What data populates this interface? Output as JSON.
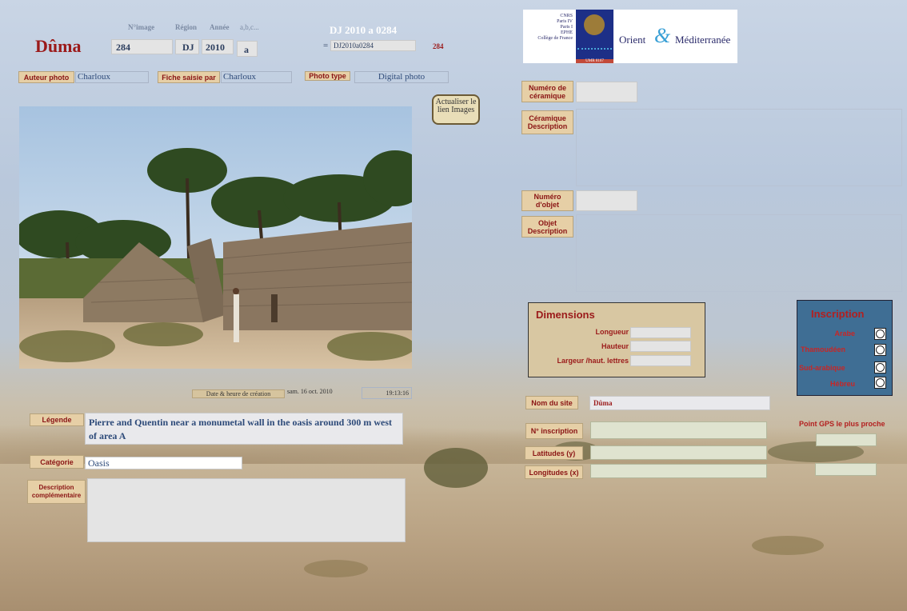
{
  "header": {
    "site_title": "Dûma",
    "labels": {
      "n_image": "N°image",
      "region": "Région",
      "annee": "Année",
      "abc": "a,b,c..."
    },
    "n_image_value": "284",
    "region_value": "DJ",
    "annee_value": "2010",
    "abc_value": "a",
    "ref_title": "DJ 2010 a 0284",
    "equals": "=",
    "ref_code": "DJ2010a0284",
    "ref_number": "284"
  },
  "logo": {
    "left_lines": [
      "CNRS",
      "Paris IV",
      "Paris I",
      "EPHE",
      "Collège de France"
    ],
    "umr": "UMR 8167",
    "text_orient": "Orient",
    "text_amp": "&",
    "text_med": "Méditerranée"
  },
  "photo_meta": {
    "auteur_label": "Auteur photo",
    "auteur_value": "Charloux",
    "fiche_label": "Fiche saisie par",
    "fiche_value": "Charloux",
    "type_label": "Photo type",
    "type_value": "Digital photo"
  },
  "refresh_button": "Actualiser le lien Images",
  "creation": {
    "label": "Date & heure de création",
    "date": "sam. 16 oct. 2010",
    "time": "19:13:16"
  },
  "legende": {
    "label": "Légende",
    "value": "Pierre and Quentin near a monumetal wall in the oasis around 300 m west of area A"
  },
  "categorie": {
    "label": "Catégorie",
    "value": "Oasis"
  },
  "description": {
    "label": "Description complémentaire",
    "value": ""
  },
  "ceramique": {
    "numero_label": "Numéro de céramique",
    "description_label": "Céramique Description"
  },
  "objet": {
    "numero_label": "Numéro d'objet",
    "description_label": "Objet Description"
  },
  "dimensions": {
    "title": "Dimensions",
    "fields": [
      "Longueur",
      "Hauteur",
      "Largeur /haut. lettres"
    ]
  },
  "inscription": {
    "title": "Inscription",
    "options": [
      "Arabe",
      "Thamoudéen",
      "Sud-arabique",
      "Hébreu"
    ]
  },
  "site": {
    "label": "Nom du site",
    "value": "Dûma"
  },
  "inscription_fields": {
    "numero_label": "N° inscription",
    "lat_label": "Latitudes (y)",
    "lon_label": "Longitudes (x)"
  },
  "gps": {
    "label": "Point GPS le plus proche"
  },
  "colors": {
    "accent_red": "#9b1a1a",
    "button_tan": "#e6cfa6",
    "panel_blue": "#3f6e94",
    "panel_tan": "#d8c7a2"
  }
}
